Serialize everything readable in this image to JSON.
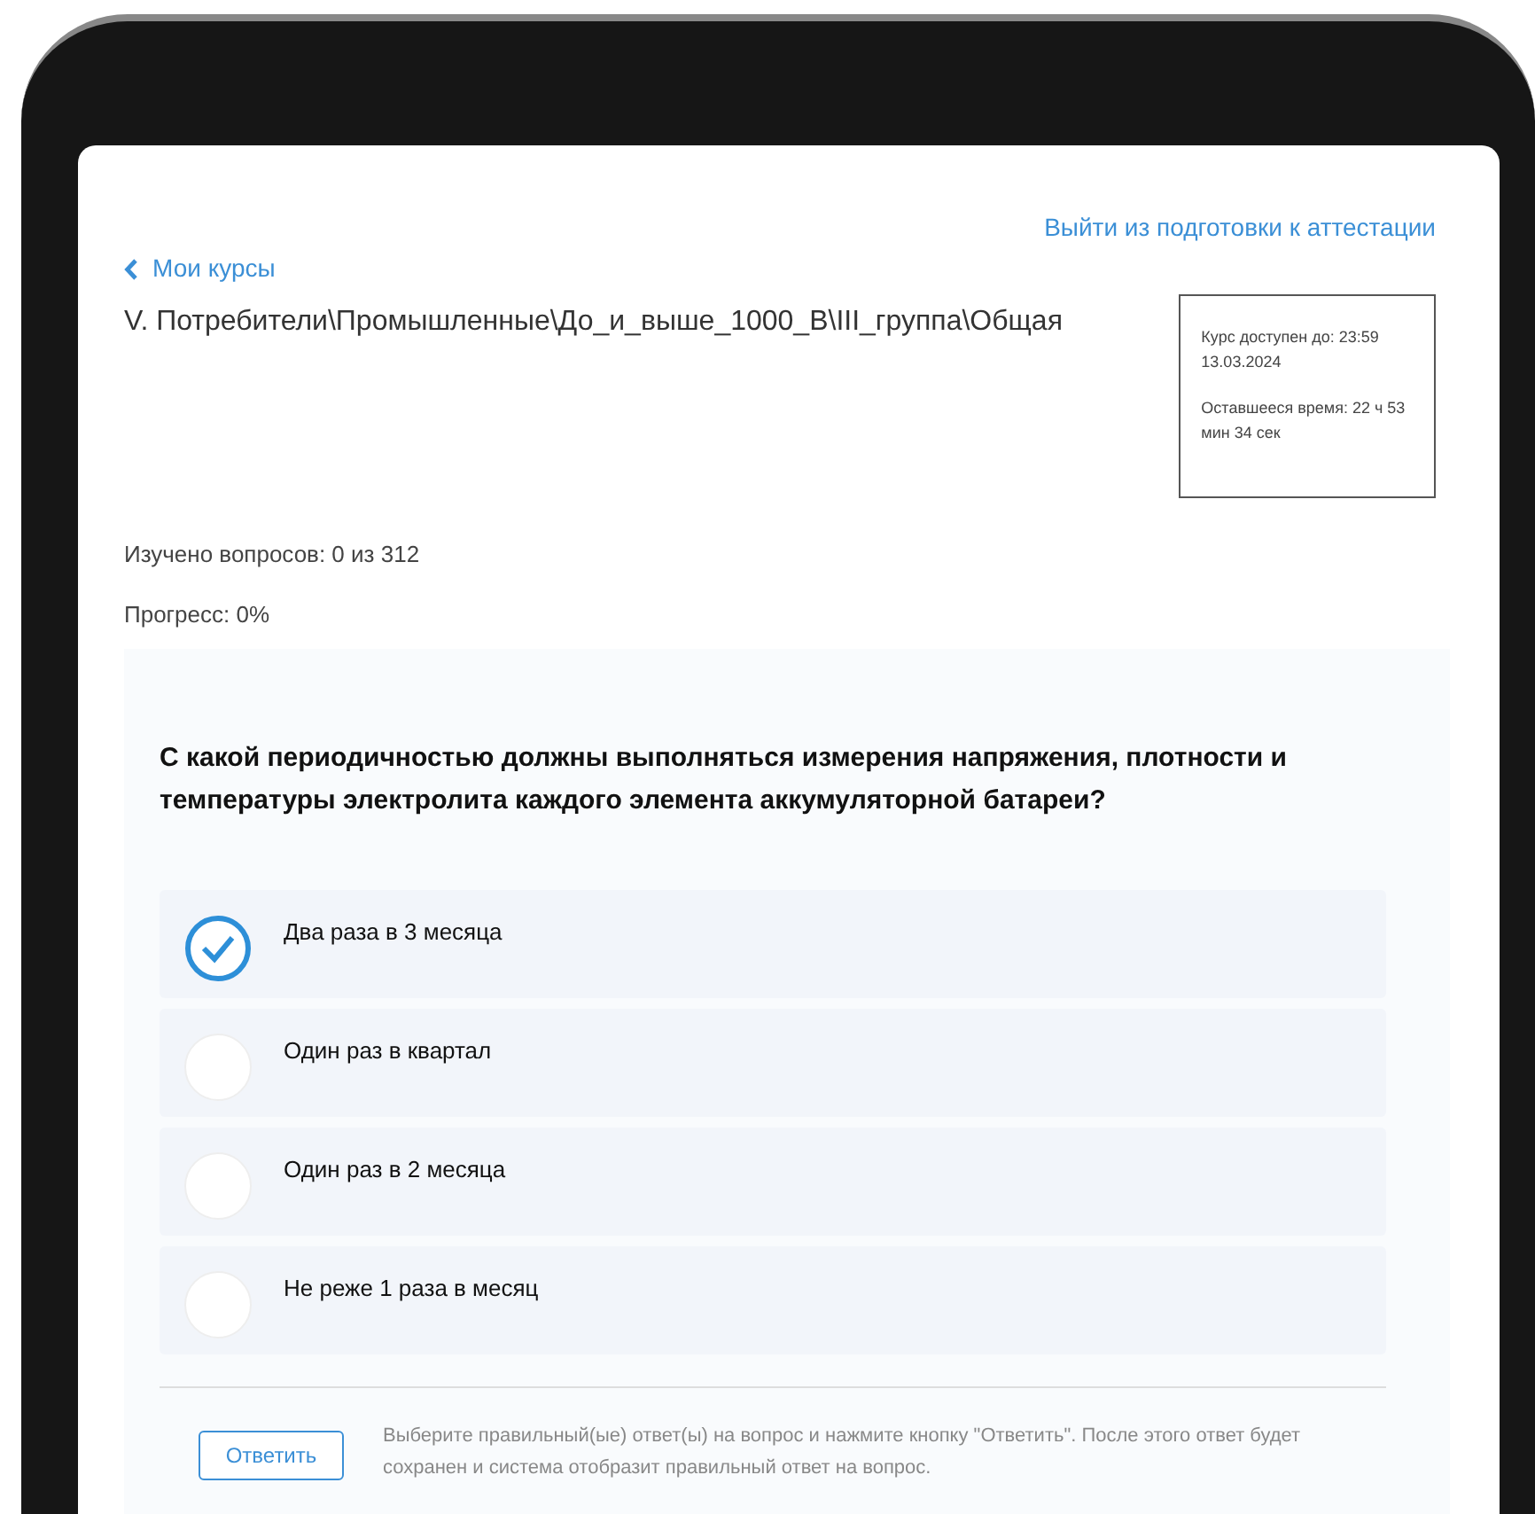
{
  "header": {
    "exit_link": "Выйти из подготовки к аттестации",
    "back_link": "Мои курсы"
  },
  "course_title": "V. Потребители\\Промышленные\\До_и_выше_1000_В\\III_группа\\Общая",
  "course_info": [
    "Курс доступен до: 23:59 13.03.2024",
    "Оставшееся время: 22 ч 53 мин 34 сек"
  ],
  "stats": [
    "Изучено вопросов: 0 из 312",
    "Прогресс: 0%"
  ],
  "question": "С какой периодичностью должны выполняться измерения напряжения, плотности и температуры электролита каждого элемента аккумуляторной батареи?",
  "options": [
    {
      "label": "Два раза в 3 месяца",
      "selected": true
    },
    {
      "label": "Один раз в квартал",
      "selected": false
    },
    {
      "label": "Один раз в 2 месяца",
      "selected": false
    },
    {
      "label": "Не реже 1 раза в месяц",
      "selected": false
    }
  ],
  "answer_button": "Ответить",
  "hint": "Выберите правильный(ые) ответ(ы) на вопрос и нажмите кнопку \"Ответить\". После этого ответ будет сохранен и система отобразит правильный ответ на вопрос."
}
